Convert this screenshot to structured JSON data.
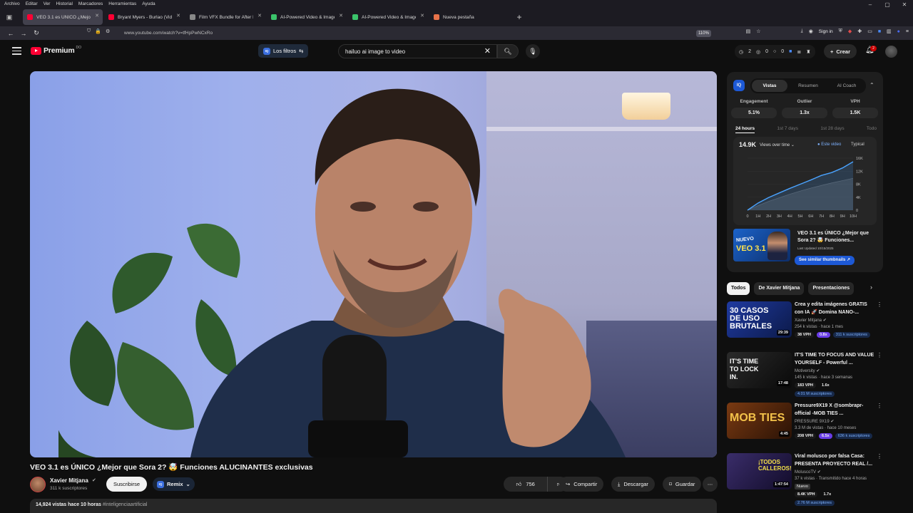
{
  "browser": {
    "menu": [
      "Archivo",
      "Editar",
      "Ver",
      "Historial",
      "Marcadores",
      "Herramientas",
      "Ayuda"
    ],
    "tabs": [
      {
        "label": "VEO 3.1 es ÚNICO ¿Mejor q",
        "active": true
      },
      {
        "label": "Bryant Myers - Burlao (Video O",
        "active": false
      },
      {
        "label": "Film VFX Bundle for After Effec",
        "active": false
      },
      {
        "label": "AI-Powered Video & Image Ge",
        "active": false
      },
      {
        "label": "AI-Powered Video & Image Ge",
        "active": false
      },
      {
        "label": "Nueva pestaña",
        "active": false
      }
    ],
    "url": "www.youtube.com/watch?v=tfHpPwNCxRo",
    "zoom": "110%",
    "sign_in": "Sign in"
  },
  "masthead": {
    "logo": "Premium",
    "logo_sup": "DO",
    "filters_label": "Los filtros",
    "search_value": "hailuo ai image to video",
    "stats": [
      "2",
      "0",
      "0"
    ],
    "create_label": "Crear",
    "notif_count": "2"
  },
  "video": {
    "title": "VEO 3.1 es ÚNICO ¿Mejor que Sora 2? 🤯 Funciones ALUCINANTES exclusivas",
    "channel": "Xavier Mitjana",
    "subs": "311 k suscriptores",
    "subscribe": "Suscribirse",
    "remix": "Remix",
    "likes": "756",
    "share": "Compartir",
    "download": "Descargar",
    "save": "Guardar",
    "views": "14,924 vistas",
    "age": "hace 10 horas",
    "hashtag": "#inteligenciaartificial"
  },
  "extension": {
    "tabs": [
      "Vistas",
      "Resumen",
      "AI Coach"
    ],
    "metrics": [
      {
        "label": "Engagement",
        "value": "5.1%"
      },
      {
        "label": "Outlier",
        "value": "1.3x"
      },
      {
        "label": "VPH",
        "value": "1.5K"
      }
    ],
    "ranges": [
      "24 hours",
      "1st 7 days",
      "1st 28 days",
      "Todo"
    ],
    "views_total": "14.9K",
    "views_label": "Views over time",
    "legend_este": "Este video",
    "legend_typical": "Typical",
    "thumb_title": "VEO 3.1 es ÚNICO ¿Mejor que Sora 2? 🤯 Funciones...",
    "thumb_updated": "Last Updated 10/15/2025",
    "thumb_text_1": "NUEVO",
    "thumb_text_2": "VEO 3.1",
    "similar_btn": "See similar thumbnails ↗"
  },
  "chart_data": {
    "type": "area",
    "x": [
      "0",
      "1H",
      "2H",
      "3H",
      "4H",
      "5H",
      "6H",
      "7H",
      "8H",
      "9H",
      "10H"
    ],
    "y_ticks": [
      "0",
      "4K",
      "8K",
      "12K",
      "16K"
    ],
    "ylim": [
      0,
      16000
    ],
    "series": [
      {
        "name": "Este video",
        "color": "#4aa3ff",
        "values": [
          0,
          2200,
          3900,
          5300,
          6700,
          8000,
          9300,
          10700,
          11600,
          13000,
          14900
        ]
      },
      {
        "name": "Typical",
        "color": "#5a5a5a",
        "values": [
          0,
          1400,
          2700,
          3800,
          4900,
          5900,
          6800,
          7600,
          8400,
          9100,
          9800
        ]
      }
    ]
  },
  "sidebar": {
    "chips": [
      "Todos",
      "De Xavier Mitjana",
      "Presentaciones"
    ],
    "recs": [
      {
        "title": "Crea y edita imágenes GRATIS con IA 🚀 Domina NANO-...",
        "channel": "Xavier Mitjana",
        "meta": "254 k vistas · hace 1 mes",
        "duration": "29:39",
        "vph": "38 VPH",
        "outlier": "0.8x",
        "subs": "311 k suscriptores",
        "thumb_text": "30 CASOS DE USO BRUTALES",
        "thumb_color": "#1f3aa0"
      },
      {
        "title": "IT'S TIME TO FOCUS AND VALUE YOURSELF - Powerful ...",
        "channel": "Motiversity",
        "meta": "145 k vistas · hace 3 semanas",
        "duration": "17:48",
        "vph": "183 VPH",
        "outlier": "1.6x",
        "subs": "4.01 M suscriptores",
        "thumb_text": "IT'S TIME TO LOCK IN.",
        "thumb_color": "#1a1a1a"
      },
      {
        "title": "Pressure9X19 X @sombrapr-official -MOB TIES ...",
        "channel": "PRESSURE 9X19",
        "meta": "3.3 M de vistas · hace 10 meses",
        "duration": "4:45",
        "vph": "208 VPH",
        "outlier": "6.5x",
        "subs": "636 k suscriptores",
        "thumb_text": "MOB TIES",
        "thumb_color": "#5a2a10"
      },
      {
        "title": "Viral molusco por falsa Casa: PRESENTA PROYECTO REAL /...",
        "channel": "MoluscoTV",
        "meta": "37 k vistas · Transmitido hace 4 horas",
        "duration": "1:47:54",
        "live": "Nuevo",
        "vph": "8.4K VPH",
        "outlier": "1.7x",
        "subs": "2.76 M suscriptores",
        "thumb_text": "¡TODOS CALLEROS!",
        "thumb_color": "#2a1f50"
      }
    ]
  },
  "colors": {
    "accent": "#ff0033",
    "iq_blue": "#1d59d6",
    "outlier_purple": "#6a3de8"
  }
}
